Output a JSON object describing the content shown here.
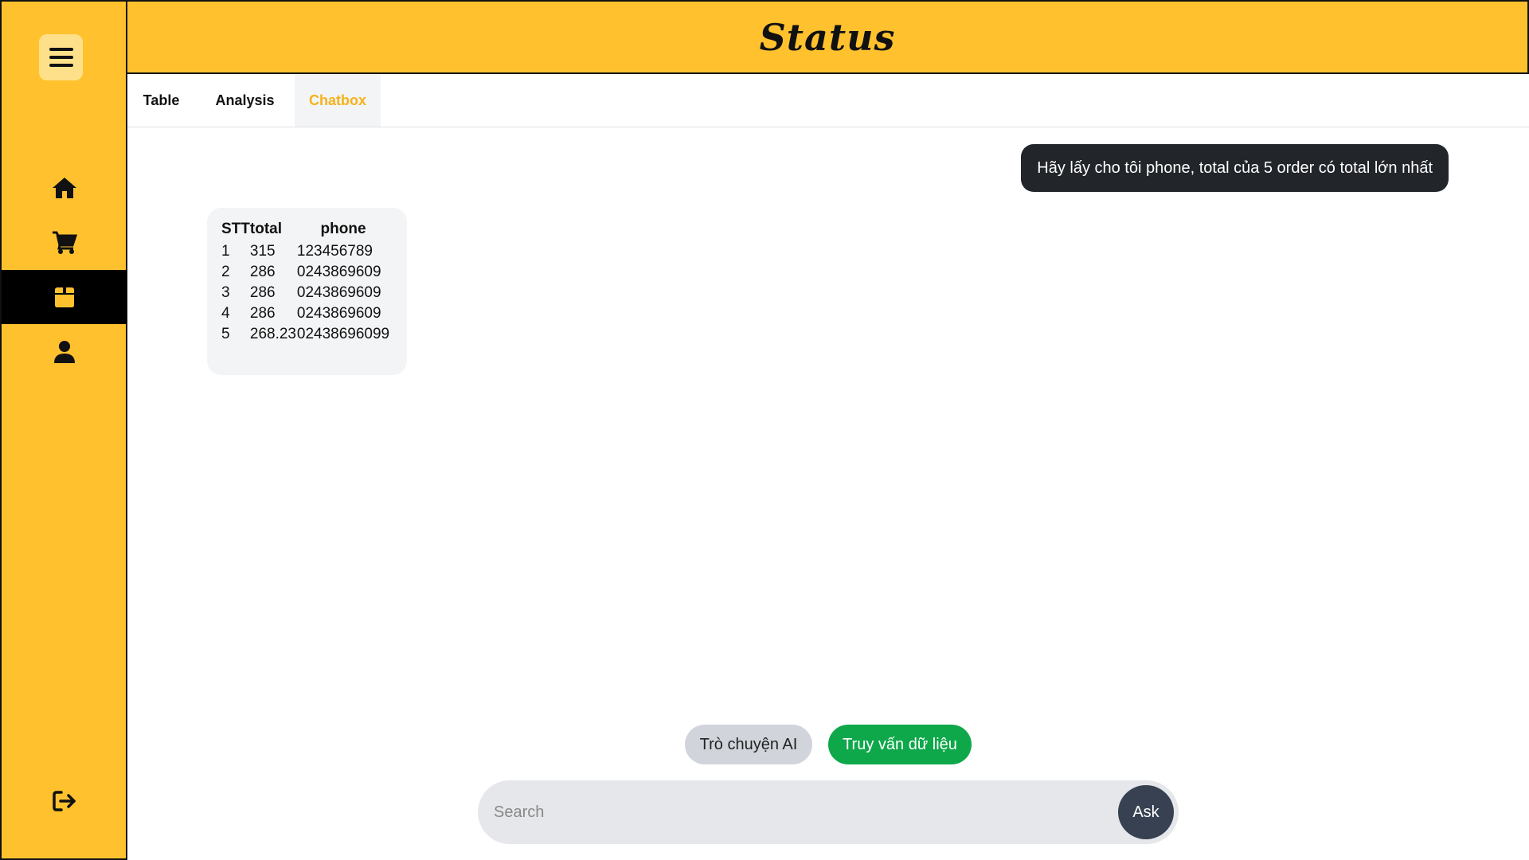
{
  "header": {
    "title": "Status"
  },
  "sidebar": {
    "menu_icon": "hamburger-menu-icon",
    "items": [
      {
        "icon": "home-icon",
        "active": false
      },
      {
        "icon": "cart-icon",
        "active": false
      },
      {
        "icon": "box-icon",
        "active": true
      },
      {
        "icon": "user-icon",
        "active": false
      }
    ],
    "logout_icon": "logout-icon"
  },
  "tabs": [
    {
      "label": "Table"
    },
    {
      "label": "Analysis"
    },
    {
      "label": "Chatbox",
      "active": true
    }
  ],
  "chat": {
    "user_message": "Hãy lấy cho tôi phone, total của 5 order có total lớn nhất",
    "result": {
      "headers": [
        "STT",
        "total",
        "phone"
      ],
      "rows": [
        [
          "1",
          "315",
          "123456789"
        ],
        [
          "2",
          "286",
          "0243869609"
        ],
        [
          "3",
          "286",
          "0243869609"
        ],
        [
          "4",
          "286",
          "0243869609"
        ],
        [
          "5",
          "268.23",
          "02438696099"
        ]
      ]
    }
  },
  "modes": {
    "ai_label": "Trò chuyện AI",
    "data_label": "Truy vấn dữ liệu"
  },
  "search": {
    "placeholder": "Search",
    "ask_label": "Ask"
  },
  "colors": {
    "accent": "#ffc22e",
    "active_tab": "#f5b21a",
    "data_button": "#0ea84a",
    "user_bubble": "#22252a"
  }
}
